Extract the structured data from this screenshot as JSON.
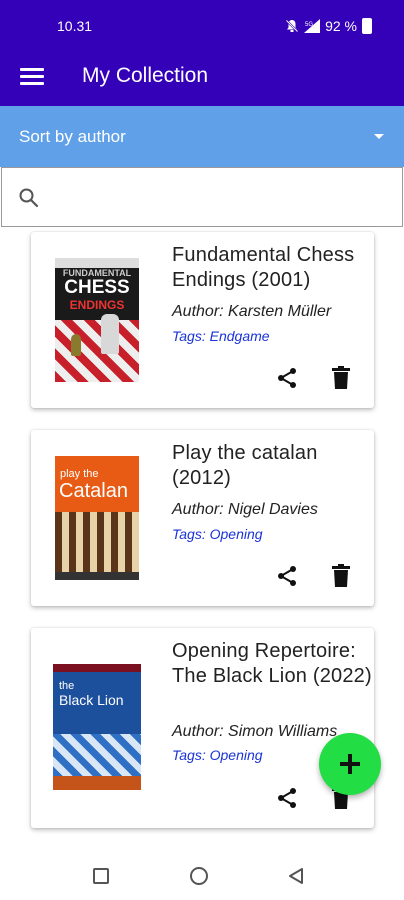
{
  "status_bar": {
    "time": "10.31",
    "battery": "92 %"
  },
  "app_bar": {
    "title": "My Collection"
  },
  "sort": {
    "selected": "Sort by author"
  },
  "search": {
    "placeholder": "",
    "value": ""
  },
  "books": [
    {
      "title": "Fundamental Chess Endings (2001)",
      "author": "Author: Karsten Müller",
      "tags": "Tags: Endgame",
      "cover_text_top": "FUNDAMENTAL",
      "cover_text_main": "CHESS",
      "cover_text_sub": "ENDINGS"
    },
    {
      "title": "Play the catalan (2012)",
      "author": "Author: Nigel Davies",
      "tags": "Tags: Opening",
      "cover_text_top": "play the",
      "cover_text_main": "Catalan"
    },
    {
      "title": "Opening Repertoire: The Black Lion (2022)",
      "author": "Author: Simon Williams",
      "tags": "Tags: Opening",
      "cover_text_top": "the",
      "cover_text_main": "Black Lion"
    }
  ],
  "colors": {
    "primary": "#3400b8",
    "sort_bar": "#5fa0e8",
    "fab": "#22dd44",
    "tag": "#1a33d6"
  }
}
